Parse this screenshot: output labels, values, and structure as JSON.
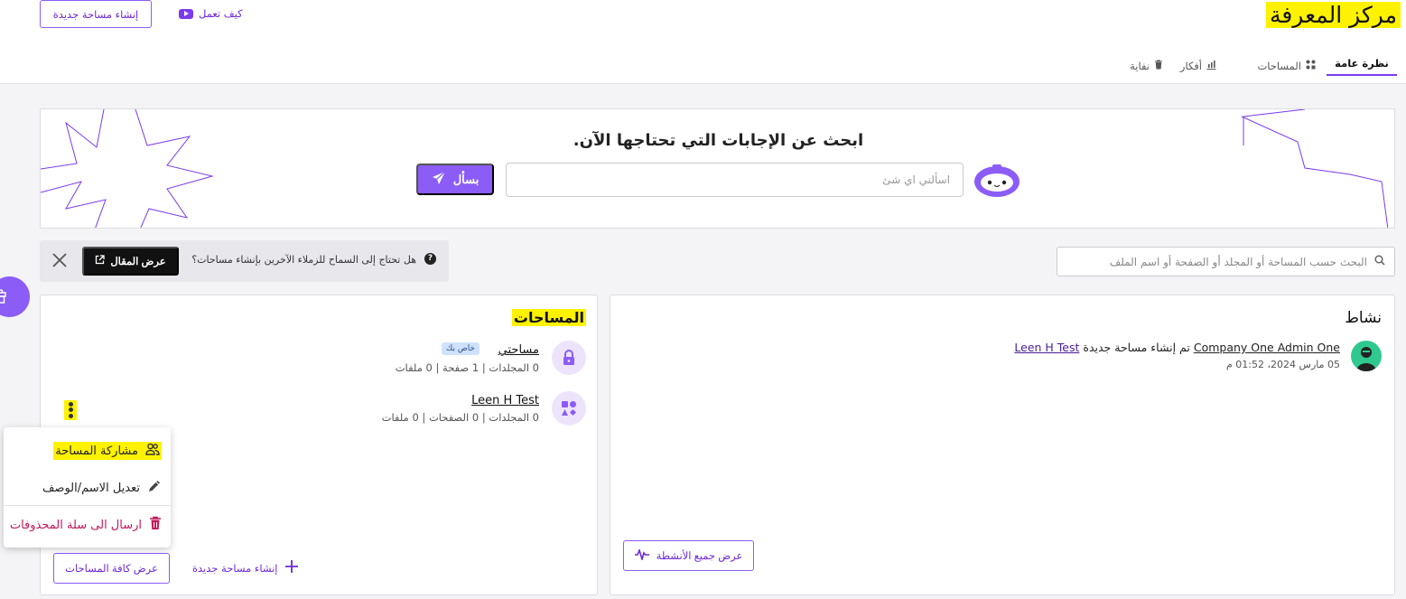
{
  "header": {
    "title": "مركز المعرفة",
    "create_space_label": "إنشاء مساحة جديدة",
    "how_it_works_label": "كيف تعمل"
  },
  "tabs": [
    {
      "label": "نظرة عامة",
      "icon": "none",
      "active": true
    },
    {
      "label": "المساحات",
      "icon": "grid-icon"
    },
    {
      "label": "أفكار",
      "icon": "chart-icon"
    },
    {
      "label": "نفاية",
      "icon": "trash-icon"
    }
  ],
  "hero": {
    "title": "ابحث عن الإجابات التي تحتاجها الآن.",
    "input_placeholder": "اسألني اي شئ",
    "ask_label": "بسأل"
  },
  "notice": {
    "text": "هل تحتاج إلى السماح للزملاء الآخرين بإنشاء مساحات؟",
    "button_label": "عرض المقال"
  },
  "search": {
    "placeholder": "البحث حسب المساحة أو المجلد أو الصفحة أو اسم الملف"
  },
  "activity": {
    "title": "نشاط",
    "entry": {
      "actor": "Company One Admin One",
      "action": "تم إنشاء مساحة جديدة",
      "target": "Leen H Test",
      "time": "05 مارس 2024، 01:52 م"
    },
    "view_all_label": "عرض جميع الأنشطة"
  },
  "spaces": {
    "title": "المساحات",
    "items": [
      {
        "name": "مساحتي",
        "badge": "خاص بك",
        "meta": "0 المجلدات | 1 صفحة | 0 ملفات",
        "icon": "lock-icon"
      },
      {
        "name": "Leen H Test",
        "meta": "0 المجلدات | 0 الصفحات | 0 ملفات",
        "icon": "shapes-icon"
      }
    ],
    "view_all_label": "عرض كافة المساحات",
    "create_label": "إنشاء مساحة جديدة"
  },
  "context_menu": {
    "items": [
      {
        "label": "مشاركة المساحة",
        "icon": "users-icon"
      },
      {
        "label": "تعديل الاسم/الوصف",
        "icon": "pencil-icon"
      },
      {
        "label": "ارسال الى سلة المحذوفات",
        "icon": "trash-icon"
      }
    ]
  },
  "colors": {
    "accent": "#8b5cf6",
    "accent_dark": "#6d28d9",
    "danger": "#c2185b",
    "highlight": "#fff200"
  }
}
